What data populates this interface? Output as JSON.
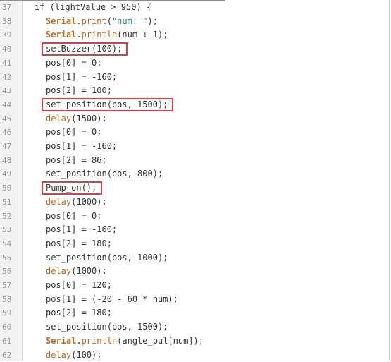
{
  "colors": {
    "line_number": "#9a9a9a",
    "plain_code": "#333333",
    "arduino_function": "#c06a1c",
    "string_literal": "#1f7a86",
    "highlight_box": "#e23b46",
    "gutter_background": "#f2f2f2"
  },
  "code_lines": [
    {
      "num": "37",
      "indent": 0,
      "tokens": [
        {
          "t": "plain",
          "v": "if (lightValue > 950) {"
        }
      ]
    },
    {
      "num": "38",
      "indent": 1,
      "tokens": [
        {
          "t": "obj",
          "v": "Serial"
        },
        {
          "t": "plain",
          "v": "."
        },
        {
          "t": "func",
          "v": "print"
        },
        {
          "t": "plain",
          "v": "("
        },
        {
          "t": "str",
          "v": "\"num: \""
        },
        {
          "t": "plain",
          "v": ");"
        }
      ]
    },
    {
      "num": "39",
      "indent": 1,
      "tokens": [
        {
          "t": "obj",
          "v": "Serial"
        },
        {
          "t": "plain",
          "v": "."
        },
        {
          "t": "func",
          "v": "println"
        },
        {
          "t": "plain",
          "v": "(num + 1);"
        }
      ]
    },
    {
      "num": "40",
      "indent": 1,
      "tokens": [
        {
          "t": "plain",
          "v": "setBuzzer(100);"
        }
      ]
    },
    {
      "num": "41",
      "indent": 1,
      "tokens": [
        {
          "t": "plain",
          "v": "pos[0] = 0;"
        }
      ]
    },
    {
      "num": "42",
      "indent": 1,
      "tokens": [
        {
          "t": "plain",
          "v": "pos[1] = -160;"
        }
      ]
    },
    {
      "num": "43",
      "indent": 1,
      "tokens": [
        {
          "t": "plain",
          "v": "pos[2] = 100;"
        }
      ]
    },
    {
      "num": "44",
      "indent": 1,
      "tokens": [
        {
          "t": "plain",
          "v": "set_position(pos, 1500);"
        }
      ]
    },
    {
      "num": "45",
      "indent": 1,
      "tokens": [
        {
          "t": "func",
          "v": "delay"
        },
        {
          "t": "plain",
          "v": "(1500);"
        }
      ]
    },
    {
      "num": "46",
      "indent": 1,
      "tokens": [
        {
          "t": "plain",
          "v": "pos[0] = 0;"
        }
      ]
    },
    {
      "num": "47",
      "indent": 1,
      "tokens": [
        {
          "t": "plain",
          "v": "pos[1] = -160;"
        }
      ]
    },
    {
      "num": "48",
      "indent": 1,
      "tokens": [
        {
          "t": "plain",
          "v": "pos[2] = 86;"
        }
      ]
    },
    {
      "num": "49",
      "indent": 1,
      "tokens": [
        {
          "t": "plain",
          "v": "set_position(pos, 800);"
        }
      ]
    },
    {
      "num": "50",
      "indent": 1,
      "tokens": [
        {
          "t": "plain",
          "v": "Pump_on();"
        }
      ]
    },
    {
      "num": "51",
      "indent": 1,
      "tokens": [
        {
          "t": "func",
          "v": "delay"
        },
        {
          "t": "plain",
          "v": "(1000);"
        }
      ]
    },
    {
      "num": "52",
      "indent": 1,
      "tokens": [
        {
          "t": "plain",
          "v": "pos[0] = 0;"
        }
      ]
    },
    {
      "num": "53",
      "indent": 1,
      "tokens": [
        {
          "t": "plain",
          "v": "pos[1] = -160;"
        }
      ]
    },
    {
      "num": "54",
      "indent": 1,
      "tokens": [
        {
          "t": "plain",
          "v": "pos[2] = 180;"
        }
      ]
    },
    {
      "num": "55",
      "indent": 1,
      "tokens": [
        {
          "t": "plain",
          "v": "set_position(pos, 1000);"
        }
      ]
    },
    {
      "num": "56",
      "indent": 1,
      "tokens": [
        {
          "t": "func",
          "v": "delay"
        },
        {
          "t": "plain",
          "v": "(1000);"
        }
      ]
    },
    {
      "num": "57",
      "indent": 1,
      "tokens": [
        {
          "t": "plain",
          "v": "pos[0] = 120;"
        }
      ]
    },
    {
      "num": "58",
      "indent": 1,
      "tokens": [
        {
          "t": "plain",
          "v": "pos[1] = (-20 - 60 * num);"
        }
      ]
    },
    {
      "num": "59",
      "indent": 1,
      "tokens": [
        {
          "t": "plain",
          "v": "pos[2] = 180;"
        }
      ]
    },
    {
      "num": "60",
      "indent": 1,
      "tokens": [
        {
          "t": "plain",
          "v": "set_position(pos, 1500);"
        }
      ]
    },
    {
      "num": "61",
      "indent": 1,
      "tokens": [
        {
          "t": "obj",
          "v": "Serial"
        },
        {
          "t": "plain",
          "v": "."
        },
        {
          "t": "func",
          "v": "println"
        },
        {
          "t": "plain",
          "v": "(angle_pul[num]);"
        }
      ]
    },
    {
      "num": "62",
      "indent": 1,
      "tokens": [
        {
          "t": "func",
          "v": "delay"
        },
        {
          "t": "plain",
          "v": "(100);"
        }
      ]
    }
  ],
  "highlighted_lines": [
    "40",
    "44",
    "50"
  ]
}
